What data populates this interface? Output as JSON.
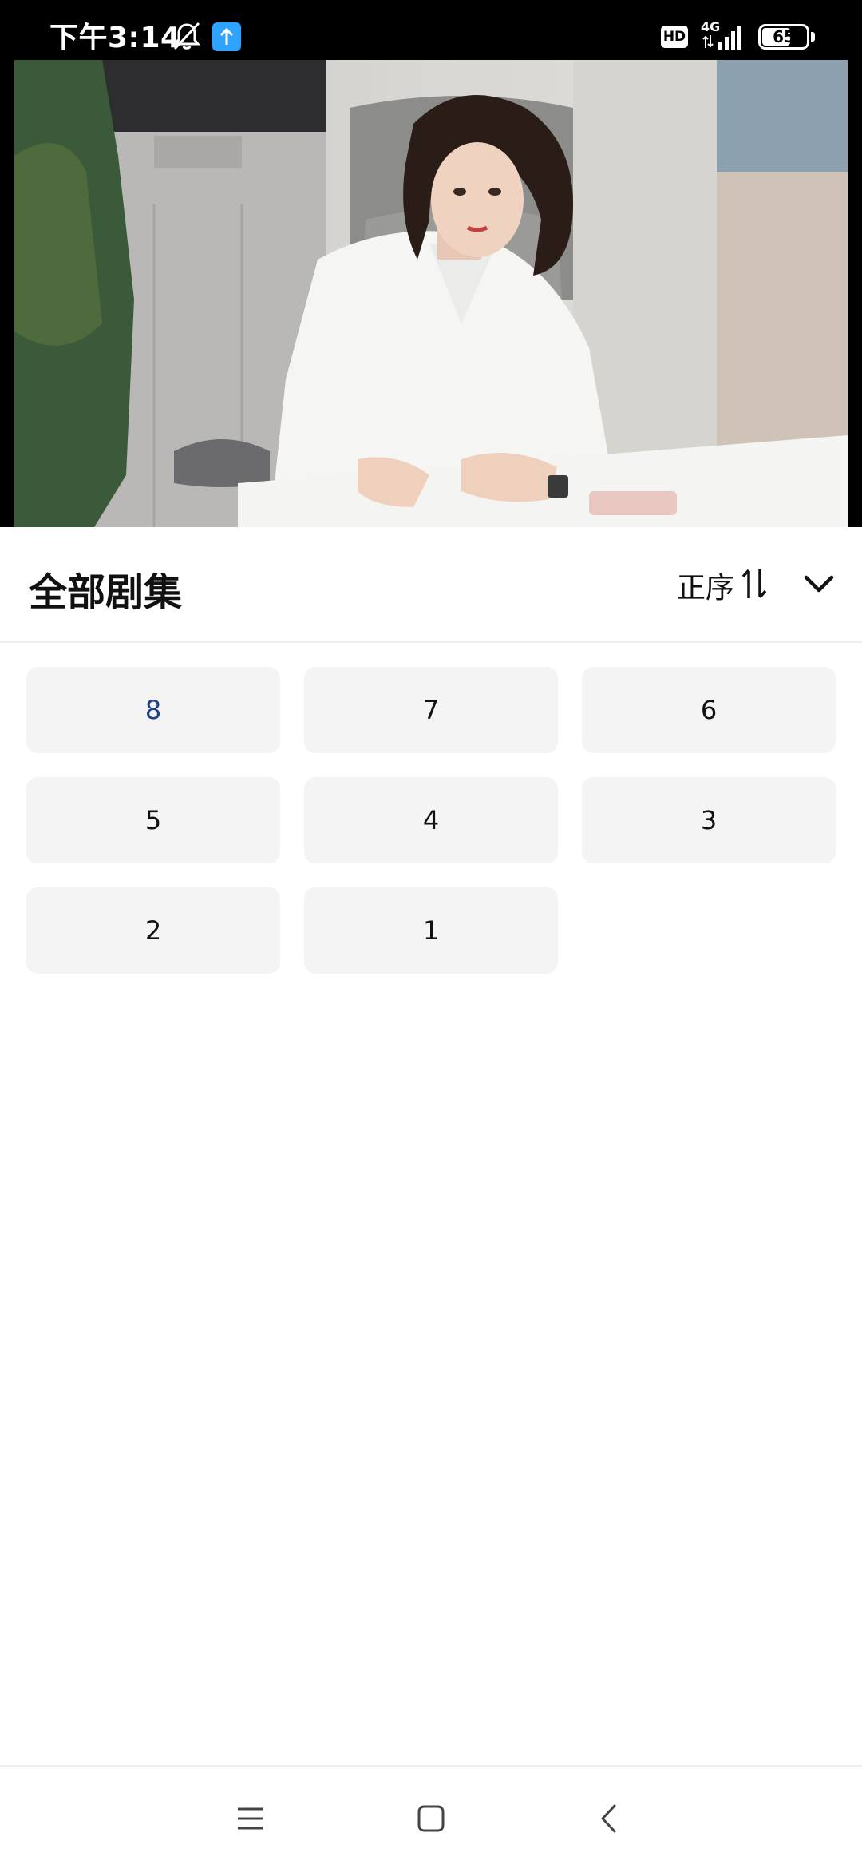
{
  "status_bar": {
    "time": "下午3:14",
    "hd_label": "HD",
    "network_label": "4G",
    "battery_level": 65,
    "battery_label": "65",
    "icons": [
      "mute-bell-icon",
      "upload-app-icon",
      "hd-icon",
      "signal-icon",
      "battery-icon"
    ]
  },
  "video": {
    "icon": "video-frame"
  },
  "episodes": {
    "title": "全部剧集",
    "sort_label": "正序",
    "sort_icon": "sort-arrows-icon",
    "collapse_icon": "chevron-down-icon",
    "items": [
      "8",
      "7",
      "6",
      "5",
      "4",
      "3",
      "2",
      "1"
    ],
    "selected": "8",
    "accent_color": "#1e3f8c"
  },
  "nav_bar": {
    "icons": [
      "menu-icon",
      "home-icon",
      "back-icon"
    ]
  }
}
